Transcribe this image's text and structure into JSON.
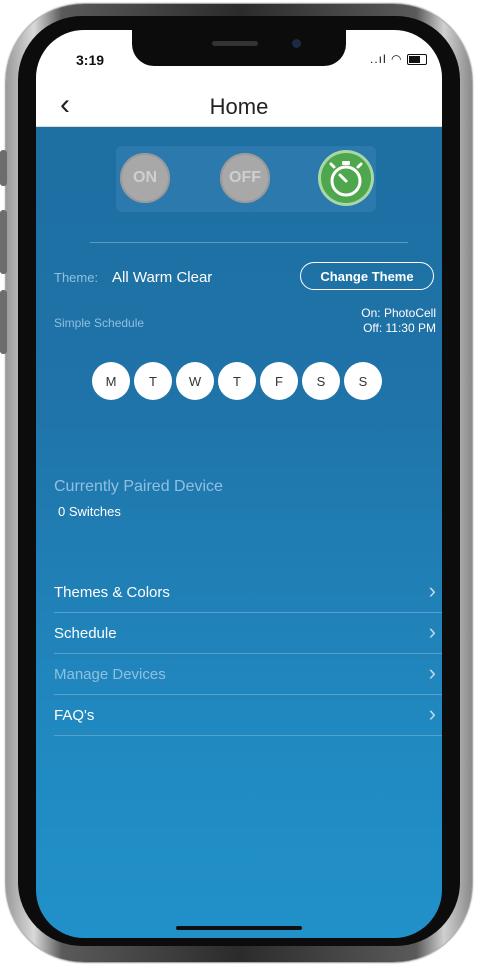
{
  "status": {
    "time": "3:19",
    "signal": "..ıl"
  },
  "nav": {
    "back": "‹",
    "title": "Home"
  },
  "controls": {
    "on": "ON",
    "off": "OFF"
  },
  "theme": {
    "label": "Theme:",
    "value": "All Warm Clear",
    "change_button": "Change Theme"
  },
  "schedule": {
    "label": "Simple Schedule",
    "on_time": "On: PhotoCell",
    "off_time": "Off: 11:30 PM",
    "days": [
      "M",
      "T",
      "W",
      "T",
      "F",
      "S",
      "S"
    ]
  },
  "paired": {
    "title": "Currently Paired Device",
    "count": "0 Switches"
  },
  "menu": [
    {
      "label": "Themes & Colors",
      "enabled": true
    },
    {
      "label": "Schedule",
      "enabled": true
    },
    {
      "label": "Manage Devices",
      "enabled": false
    },
    {
      "label": "FAQ's",
      "enabled": true
    }
  ],
  "colors": {
    "accent_green": "#4ea64d",
    "background_blue": "#1f73a8"
  }
}
